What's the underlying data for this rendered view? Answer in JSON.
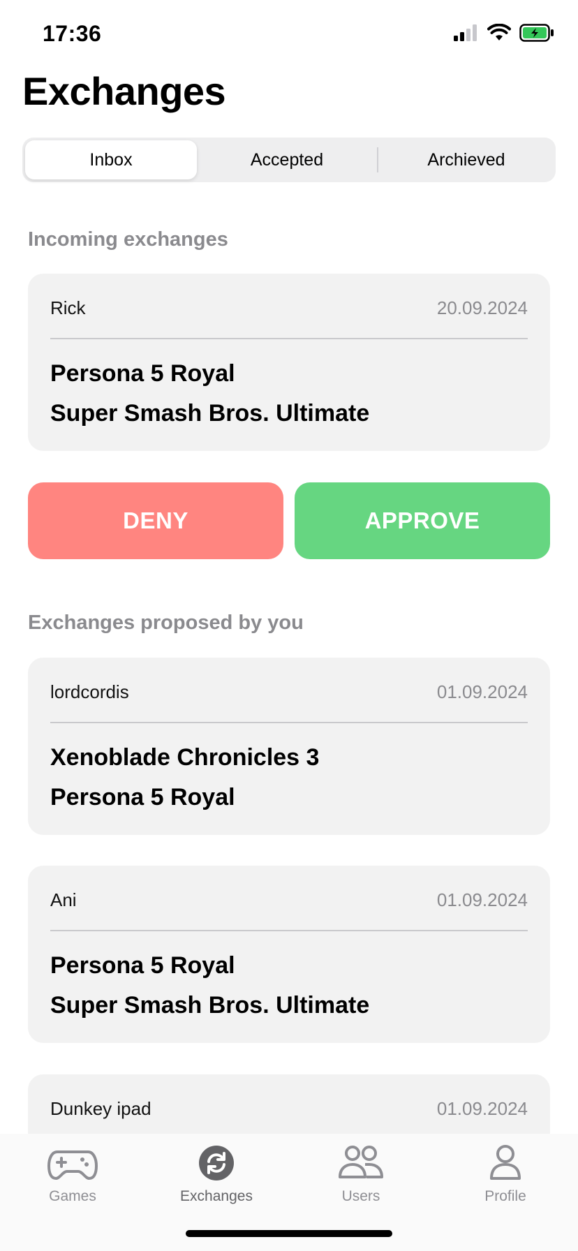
{
  "status": {
    "time": "17:36"
  },
  "title": "Exchanges",
  "segments": [
    "Inbox",
    "Accepted",
    "Archieved"
  ],
  "incoming": {
    "title": "Incoming exchanges",
    "card": {
      "user": "Rick",
      "date": "20.09.2024",
      "games": [
        "Persona 5 Royal",
        "Super Smash Bros. Ultimate"
      ]
    },
    "deny_label": "DENY",
    "approve_label": "APPROVE"
  },
  "proposed": {
    "title": "Exchanges proposed by you",
    "cards": [
      {
        "user": "lordcordis",
        "date": "01.09.2024",
        "games": [
          "Xenoblade Chronicles 3",
          "Persona 5 Royal"
        ]
      },
      {
        "user": "Ani",
        "date": "01.09.2024",
        "games": [
          "Persona 5 Royal",
          "Super Smash Bros. Ultimate"
        ]
      },
      {
        "user": "Dunkey ipad",
        "date": "01.09.2024",
        "games": []
      }
    ]
  },
  "tabs": [
    {
      "label": "Games",
      "icon": "gamepad-icon"
    },
    {
      "label": "Exchanges",
      "icon": "exchange-icon"
    },
    {
      "label": "Users",
      "icon": "users-icon"
    },
    {
      "label": "Profile",
      "icon": "person-icon"
    }
  ],
  "colors": {
    "deny": "#ff8580",
    "approve": "#66d681",
    "card": "#f2f2f2"
  }
}
